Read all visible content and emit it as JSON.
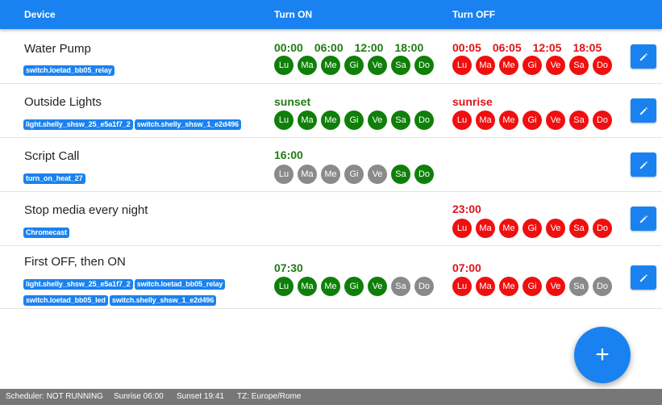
{
  "header": {
    "device_label": "Device",
    "on_label": "Turn ON",
    "off_label": "Turn OFF"
  },
  "colors": {
    "primary": "#1a82f0",
    "on_green": "#1e7d12",
    "off_red": "#e0141a",
    "day_inactive": "#8a8a8a"
  },
  "rows": [
    {
      "name": "Water Pump",
      "tags": [
        "switch.loetad_bb05_relay"
      ],
      "on_times": [
        "00:00",
        "06:00",
        "12:00",
        "18:00"
      ],
      "on_days": [
        {
          "label": "Lu",
          "active": true
        },
        {
          "label": "Ma",
          "active": true
        },
        {
          "label": "Me",
          "active": true
        },
        {
          "label": "Gi",
          "active": true
        },
        {
          "label": "Ve",
          "active": true
        },
        {
          "label": "Sa",
          "active": true
        },
        {
          "label": "Do",
          "active": true
        }
      ],
      "off_times": [
        "00:05",
        "06:05",
        "12:05",
        "18:05"
      ],
      "off_days": [
        {
          "label": "Lu",
          "active": true
        },
        {
          "label": "Ma",
          "active": true
        },
        {
          "label": "Me",
          "active": true
        },
        {
          "label": "Gi",
          "active": true
        },
        {
          "label": "Ve",
          "active": true
        },
        {
          "label": "Sa",
          "active": true
        },
        {
          "label": "Do",
          "active": true
        }
      ]
    },
    {
      "name": "Outside Lights",
      "tags": [
        "light.shelly_shsw_25_e5a1f7_2",
        "switch.shelly_shsw_1_e2d496"
      ],
      "on_times": [
        "sunset"
      ],
      "on_days": [
        {
          "label": "Lu",
          "active": true
        },
        {
          "label": "Ma",
          "active": true
        },
        {
          "label": "Me",
          "active": true
        },
        {
          "label": "Gi",
          "active": true
        },
        {
          "label": "Ve",
          "active": true
        },
        {
          "label": "Sa",
          "active": true
        },
        {
          "label": "Do",
          "active": true
        }
      ],
      "off_times": [
        "sunrise"
      ],
      "off_days": [
        {
          "label": "Lu",
          "active": true
        },
        {
          "label": "Ma",
          "active": true
        },
        {
          "label": "Me",
          "active": true
        },
        {
          "label": "Gi",
          "active": true
        },
        {
          "label": "Ve",
          "active": true
        },
        {
          "label": "Sa",
          "active": true
        },
        {
          "label": "Do",
          "active": true
        }
      ]
    },
    {
      "name": "Script Call",
      "tags": [
        "turn_on_heat_27"
      ],
      "on_times": [
        "16:00"
      ],
      "on_days": [
        {
          "label": "Lu",
          "active": false
        },
        {
          "label": "Ma",
          "active": false
        },
        {
          "label": "Me",
          "active": false
        },
        {
          "label": "Gi",
          "active": false
        },
        {
          "label": "Ve",
          "active": false
        },
        {
          "label": "Sa",
          "active": true
        },
        {
          "label": "Do",
          "active": true
        }
      ],
      "off_times": [],
      "off_days": []
    },
    {
      "name": "Stop media every night",
      "tags": [
        "Chromecast"
      ],
      "on_times": [],
      "on_days": [],
      "off_times": [
        "23:00"
      ],
      "off_days": [
        {
          "label": "Lu",
          "active": true
        },
        {
          "label": "Ma",
          "active": true
        },
        {
          "label": "Me",
          "active": true
        },
        {
          "label": "Gi",
          "active": true
        },
        {
          "label": "Ve",
          "active": true
        },
        {
          "label": "Sa",
          "active": true
        },
        {
          "label": "Do",
          "active": true
        }
      ]
    },
    {
      "name": "First OFF, then ON",
      "tags": [
        "light.shelly_shsw_25_e5a1f7_2",
        "switch.loetad_bb05_relay",
        "switch.loetad_bb05_led",
        "switch.shelly_shsw_1_e2d496"
      ],
      "on_times": [
        "07:30"
      ],
      "on_days": [
        {
          "label": "Lu",
          "active": true
        },
        {
          "label": "Ma",
          "active": true
        },
        {
          "label": "Me",
          "active": true
        },
        {
          "label": "Gi",
          "active": true
        },
        {
          "label": "Ve",
          "active": true
        },
        {
          "label": "Sa",
          "active": false
        },
        {
          "label": "Do",
          "active": false
        }
      ],
      "off_times": [
        "07:00"
      ],
      "off_days": [
        {
          "label": "Lu",
          "active": true
        },
        {
          "label": "Ma",
          "active": true
        },
        {
          "label": "Me",
          "active": true
        },
        {
          "label": "Gi",
          "active": true
        },
        {
          "label": "Ve",
          "active": true
        },
        {
          "label": "Sa",
          "active": false
        },
        {
          "label": "Do",
          "active": false
        }
      ]
    }
  ],
  "edit_icon": "pencil-icon",
  "fab": {
    "icon": "plus-icon",
    "label": "+"
  },
  "status": {
    "scheduler": "Scheduler: NOT RUNNING",
    "sunrise": "Sunrise 06:00",
    "sunset": "Sunset 19:41",
    "tz": "TZ: Europe/Rome"
  }
}
